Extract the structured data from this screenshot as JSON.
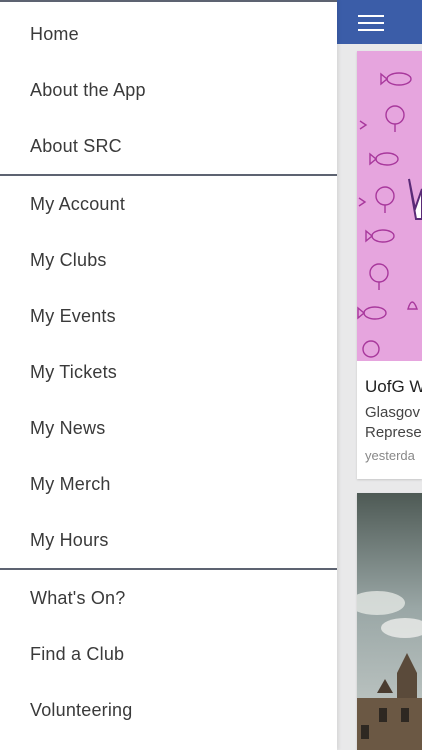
{
  "menu": {
    "group1": [
      "Home",
      "About the App",
      "About SRC"
    ],
    "group2": [
      "My Account",
      "My Clubs",
      "My Events",
      "My Tickets",
      "My News",
      "My Merch",
      "My Hours"
    ],
    "group3": [
      "What's On?",
      "Find a Club",
      "Volunteering"
    ]
  },
  "feed": {
    "card1": {
      "title": "UofG W",
      "subtitle_line1": "Glasgov",
      "subtitle_line2": "Represe",
      "time": "yesterda"
    }
  },
  "colors": {
    "header": "#3b5da8",
    "divider": "#5d6371",
    "card_image_pink": "#e3a3dc"
  }
}
